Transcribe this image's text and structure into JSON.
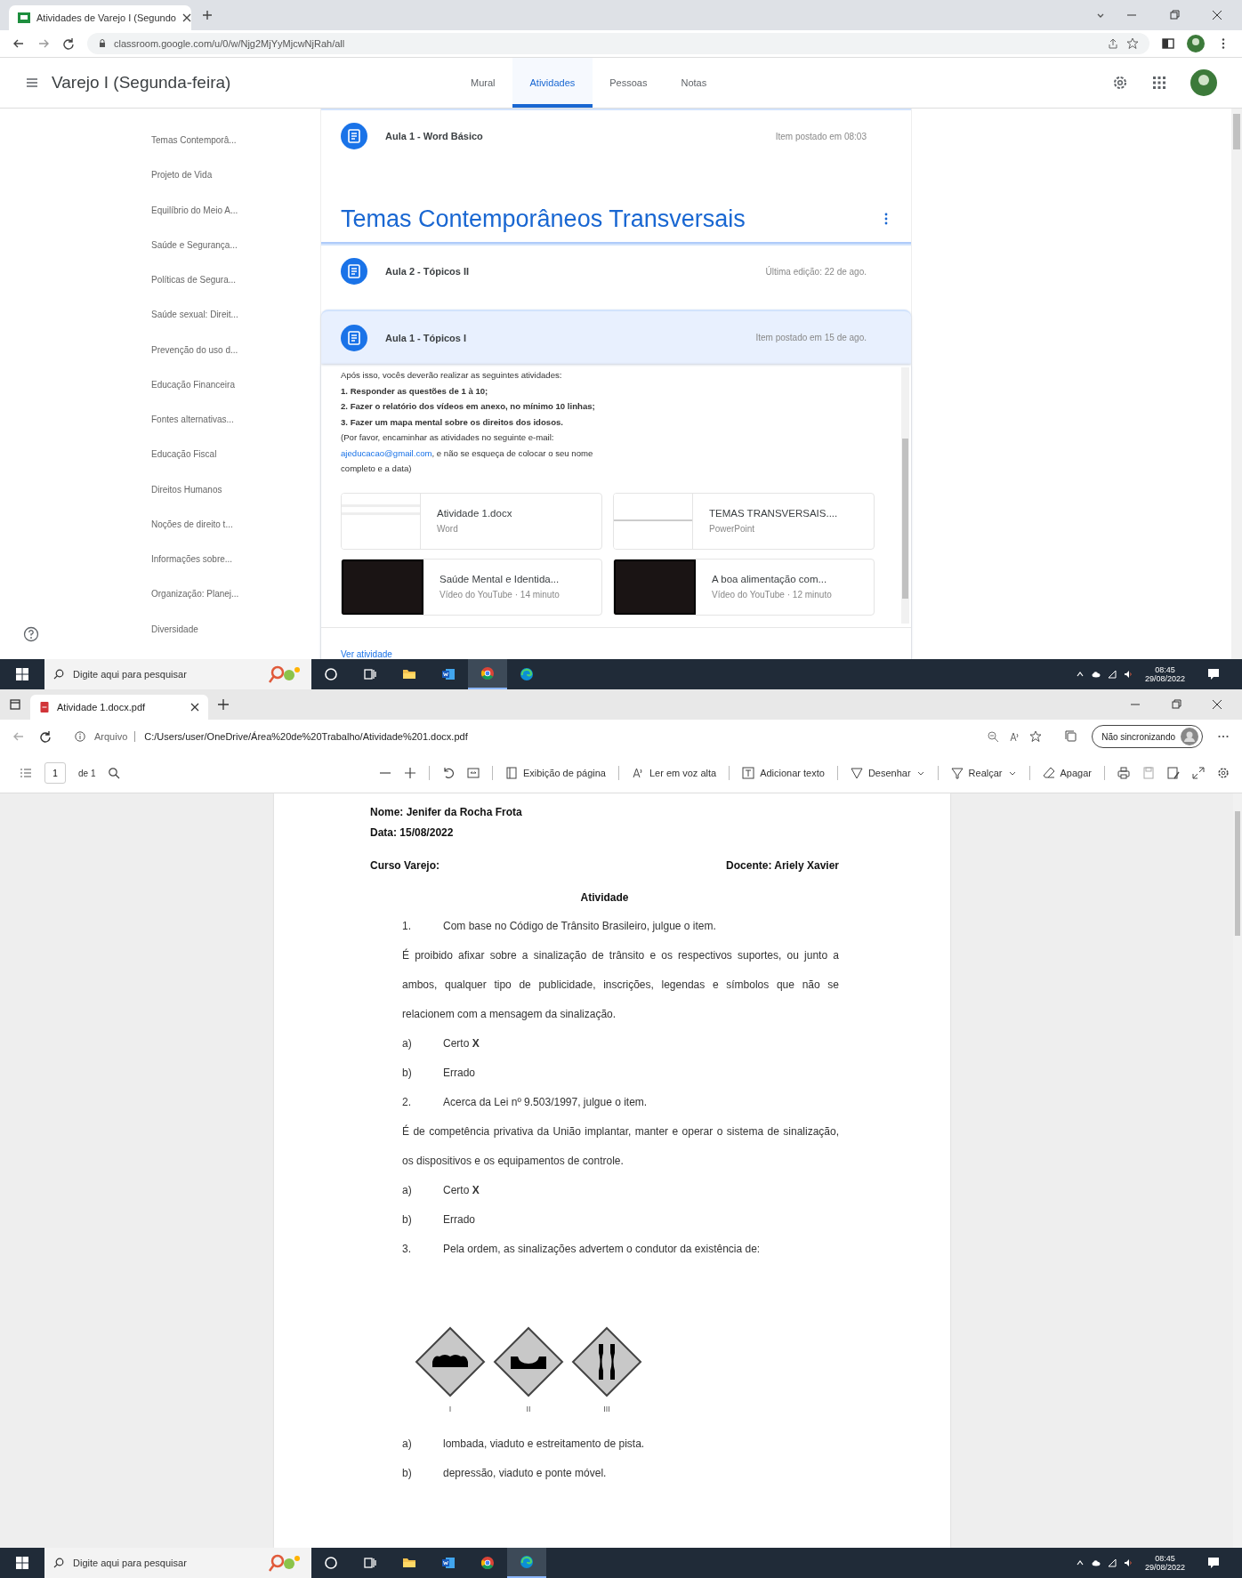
{
  "chrome": {
    "tab_title": "Atividades de Varejo I (Segundo",
    "url": "classroom.google.com/u/0/w/Njg2MjYyMjcwNjRah/all"
  },
  "classroom": {
    "title": "Varejo I (Segunda-feira)",
    "nav_tabs": [
      {
        "label": "Mural",
        "selected": false
      },
      {
        "label": "Atividades",
        "selected": true
      },
      {
        "label": "Pessoas",
        "selected": false
      },
      {
        "label": "Notas",
        "selected": false
      }
    ],
    "sidebar": [
      "Temas Contemporâ...",
      "Projeto de Vida",
      "Equilíbrio do Meio A...",
      "Saúde e Segurança...",
      "Políticas de Segura...",
      "Saúde sexual: Direit...",
      "Prevenção do uso d...",
      "Educação Financeira",
      "Fontes alternativas...",
      "Educação Fiscal",
      "Direitos Humanos",
      "Noções de direito t...",
      "Informações sobre...",
      "Organização: Planej...",
      "Diversidade"
    ],
    "first_item": {
      "title": "Aula 1 - Word Básico",
      "meta": "Item postado em 08:03"
    },
    "topic": {
      "title": "Temas Contemporâneos Transversais",
      "items": [
        {
          "title": "Aula 2 - Tópicos II",
          "meta": "Última edição: 22 de ago.",
          "expanded": false
        },
        {
          "title": "Aula 1 - Tópicos I",
          "meta": "Item postado em 15 de ago.",
          "expanded": true
        }
      ]
    },
    "details": [
      {
        "kind": "plain",
        "text": "Após isso, vocês deverão realizar as seguintes atividades:"
      },
      {
        "kind": "bold",
        "text": "1. Responder as questões de 1 à 10;"
      },
      {
        "kind": "bold",
        "text": "2. Fazer o relatório dos vídeos em anexo, no mínimo 10 linhas;"
      },
      {
        "kind": "bold",
        "text": "3. Fazer um mapa mental sobre os direitos dos idosos."
      },
      {
        "kind": "plain",
        "text": "(Por favor, encaminhar as atividades no seguinte e-mail:"
      },
      {
        "kind": "link",
        "link": "ajeducacao@gmail.com",
        "text": ", e não se esqueça de colocar o seu nome"
      },
      {
        "kind": "plain",
        "text": "completo e a data)"
      }
    ],
    "attachments": [
      {
        "kind": "doc",
        "title": "Atividade 1.docx",
        "sub": "Word"
      },
      {
        "kind": "slides",
        "title": "TEMAS TRANSVERSAIS....",
        "sub": "PowerPoint"
      },
      {
        "kind": "video",
        "title": "Saúde Mental e Identida...",
        "sub": "Vídeo do YouTube · 14 minuto"
      },
      {
        "kind": "video",
        "title": "A boa alimentação com...",
        "sub": "Vídeo do YouTube · 12 minuto"
      }
    ],
    "view_link": "Ver atividade"
  },
  "taskbar_top": {
    "search_placeholder": "Digite aqui para pesquisar",
    "time": "08:45",
    "date": "29/08/2022"
  },
  "edge": {
    "tab_title": "Atividade 1.docx.pdf",
    "file_label": "Arquivo",
    "url": "C:/Users/user/OneDrive/Área%20de%20Trabalho/Atividade%201.docx.pdf",
    "sync": "Não sincronizando",
    "page": "1",
    "page_total": "de 1",
    "tools": [
      {
        "kind": "page",
        "label": "Exibição de página",
        "dropdown": false
      },
      {
        "kind": "read",
        "label": "Ler em voz alta",
        "dropdown": false
      },
      {
        "kind": "text",
        "label": "Adicionar texto",
        "dropdown": false
      },
      {
        "kind": "draw",
        "label": "Desenhar",
        "dropdown": true
      },
      {
        "kind": "highlight",
        "label": "Realçar",
        "dropdown": true
      },
      {
        "kind": "erase",
        "label": "Apagar",
        "dropdown": false
      }
    ]
  },
  "pdf": {
    "name": "Nome: Jenifer da Rocha Frota",
    "date": "Data: 15/08/2022",
    "course": "Curso Varejo:",
    "teacher": "Docente: Ariely Xavier",
    "heading": "Atividade",
    "blocks": [
      {
        "kind": "item",
        "mark": "1.",
        "text": "Com base no Código de Trânsito Brasileiro, julgue o item."
      },
      {
        "kind": "paragraph",
        "text": "É proibido afixar sobre a sinalização de trânsito e os respectivos suportes, ou junto a ambos, qualquer tipo de publicidade, inscrições, legendas e símbolos que não se relacionem com a mensagem da sinalização."
      },
      {
        "kind": "item",
        "mark": "a)",
        "text": "Certo **X**"
      },
      {
        "kind": "item",
        "mark": "b)",
        "text": "Errado"
      },
      {
        "kind": "item",
        "mark": "2.",
        "text": "Acerca da Lei nº 9.503/1997, julgue o item."
      },
      {
        "kind": "paragraph",
        "text": "É de competência privativa da União implantar, manter e operar o sistema de sinalização, os dispositivos e os equipamentos de controle."
      },
      {
        "kind": "item",
        "mark": "a)",
        "text": "Certo **X**"
      },
      {
        "kind": "item",
        "mark": "b)",
        "text": "Errado"
      },
      {
        "kind": "item",
        "mark": "3.",
        "text": "Pela ordem, as sinalizações advertem o condutor da existência de:"
      },
      {
        "kind": "signs",
        "labels": [
          "I",
          "II",
          "III"
        ]
      },
      {
        "kind": "item",
        "mark": "a)",
        "text": "lombada, viaduto e estreitamento de pista."
      },
      {
        "kind": "item",
        "mark": "b)",
        "text": "depressão, viaduto e ponte móvel."
      }
    ]
  },
  "taskbar_bottom": {
    "search_placeholder": "Digite aqui para pesquisar",
    "time": "08:45",
    "date": "29/08/2022"
  }
}
